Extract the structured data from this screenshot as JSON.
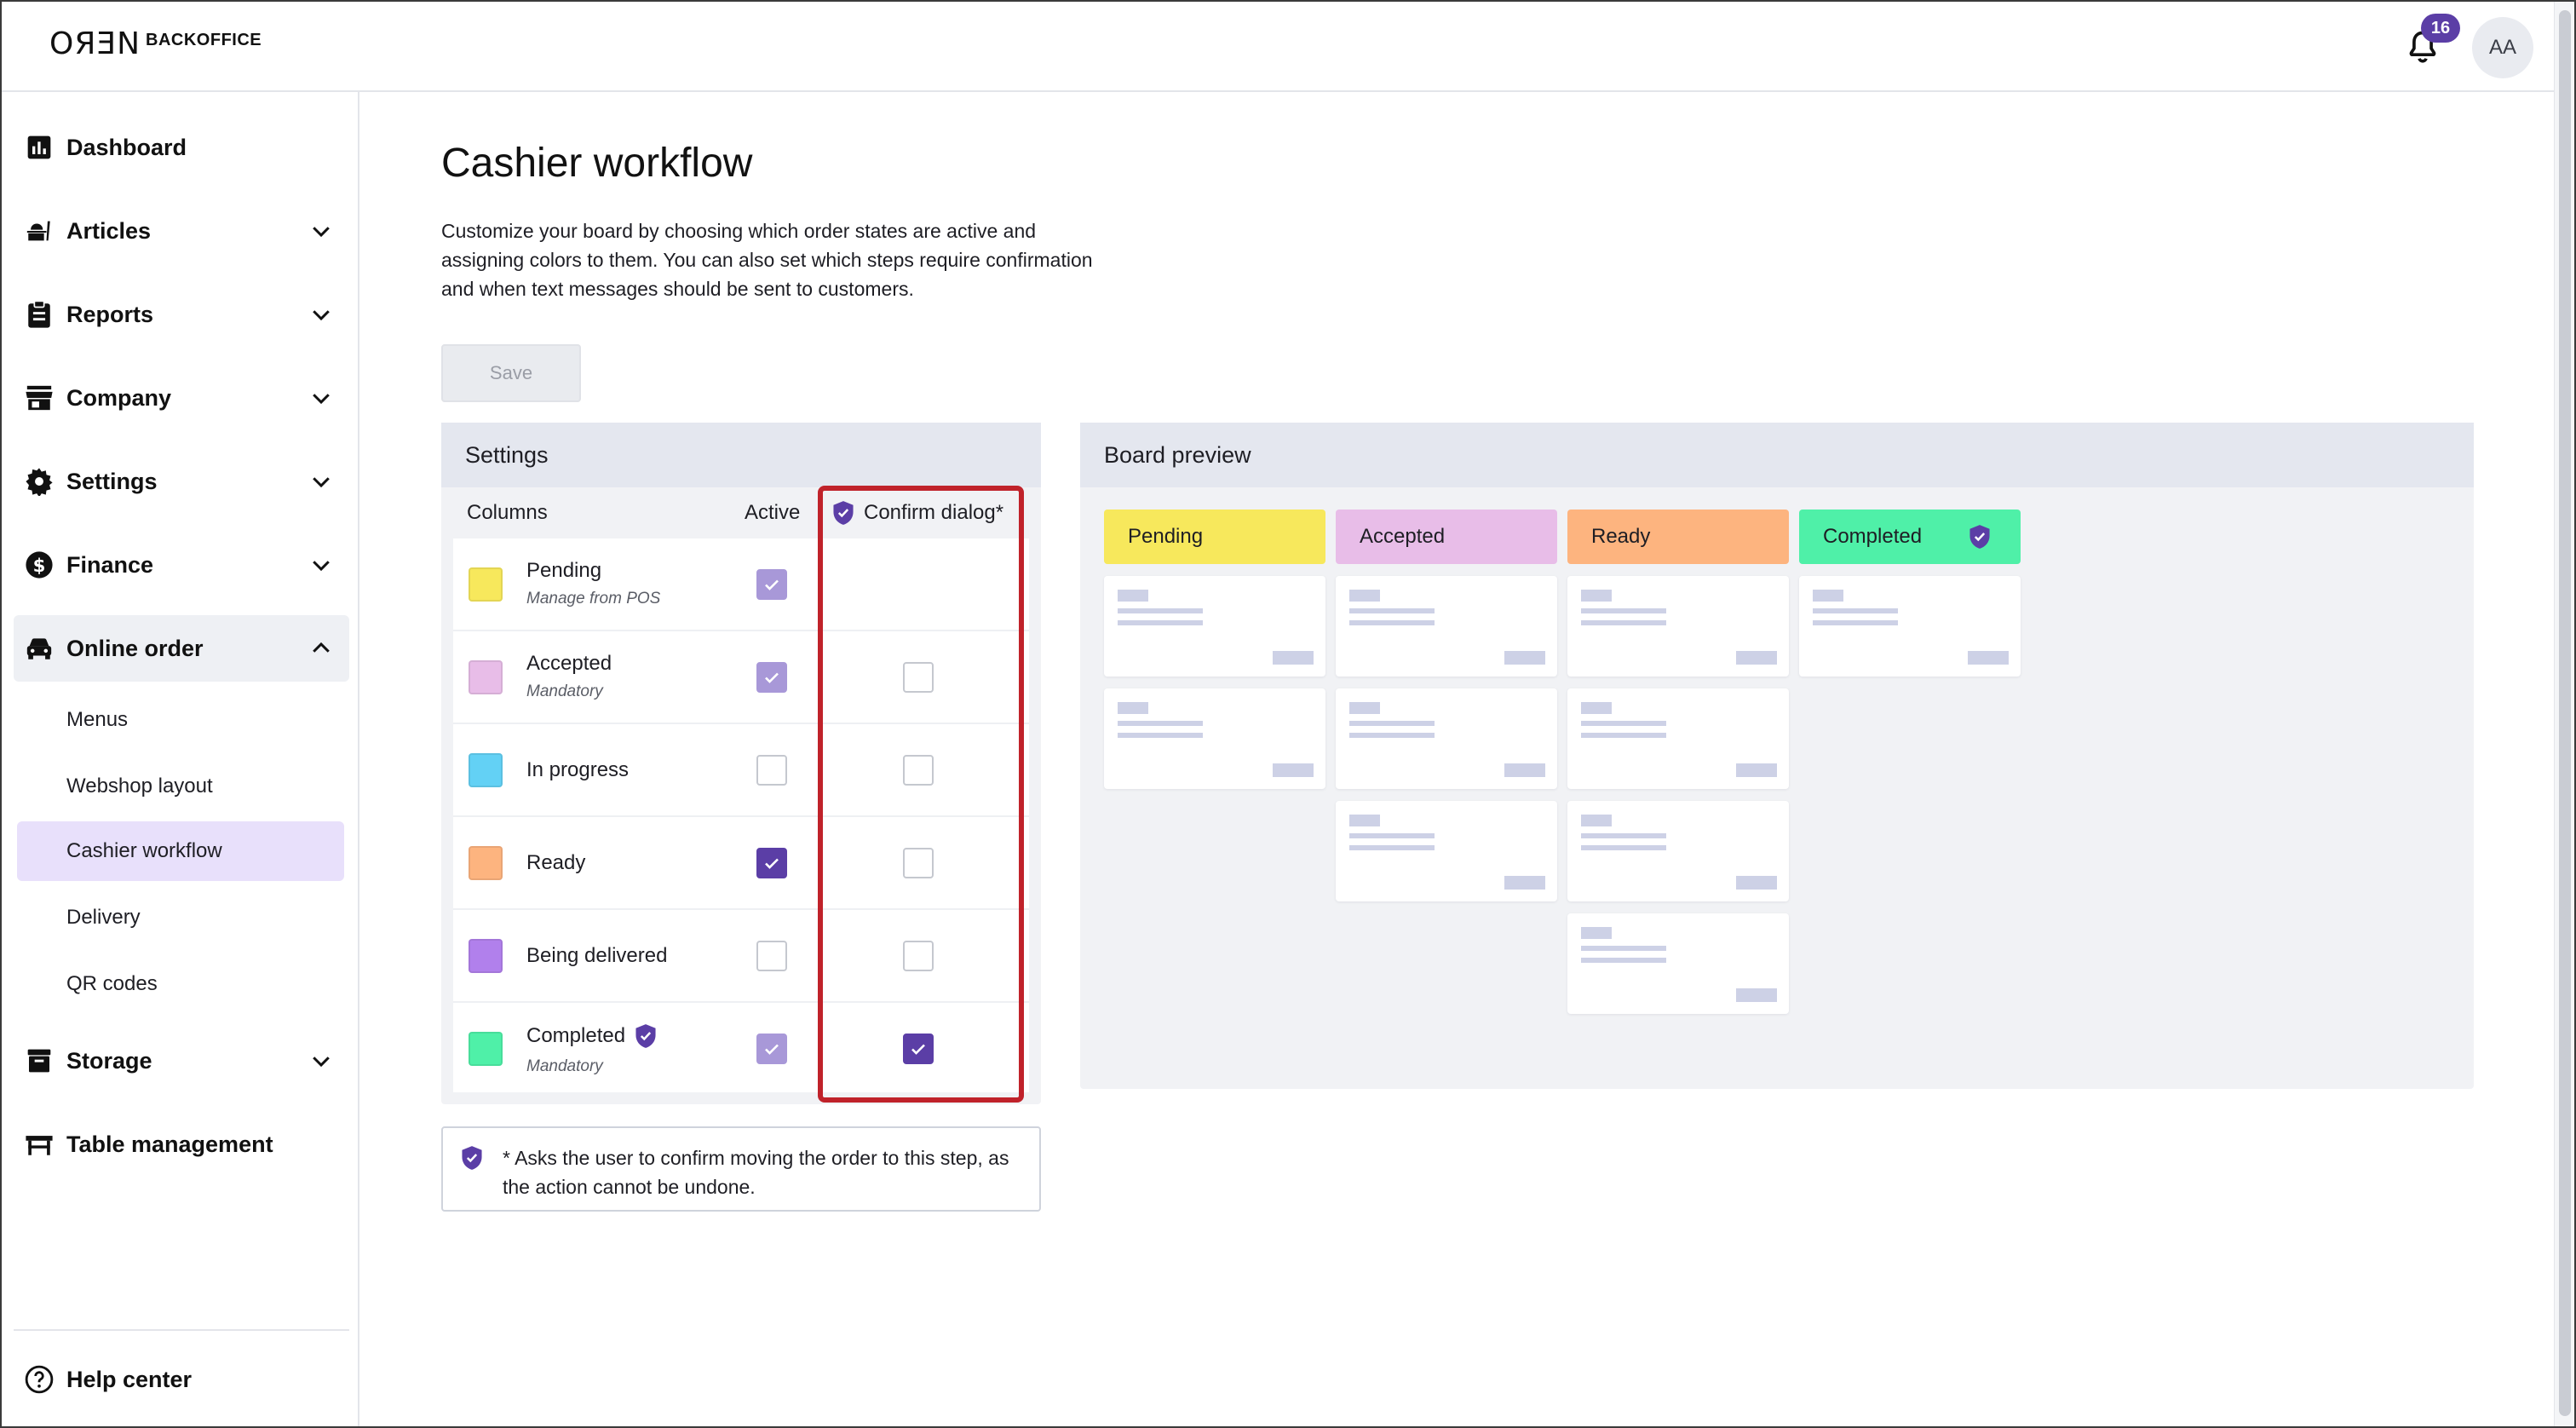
{
  "app": {
    "logo_mark": "OЯƎN",
    "logo_text": "BACKOFFICE"
  },
  "header": {
    "notification_count": "16",
    "avatar_initials": "AA"
  },
  "sidebar": {
    "items": [
      {
        "label": "Dashboard",
        "icon": "bar-chart-icon"
      },
      {
        "label": "Articles",
        "icon": "articles-icon"
      },
      {
        "label": "Reports",
        "icon": "clipboard-icon"
      },
      {
        "label": "Company",
        "icon": "store-icon"
      },
      {
        "label": "Settings",
        "icon": "gear-icon"
      },
      {
        "label": "Finance",
        "icon": "dollar-icon"
      },
      {
        "label": "Online order",
        "icon": "car-icon"
      },
      {
        "label": "Storage",
        "icon": "archive-icon"
      },
      {
        "label": "Table management",
        "icon": "table-icon"
      }
    ],
    "online_order_sub": [
      "Menus",
      "Webshop layout",
      "Cashier workflow",
      "Delivery",
      "QR codes"
    ],
    "help": "Help center"
  },
  "main": {
    "title": "Cashier workflow",
    "description": "Customize your board by choosing which order states are active and assigning colors to them. You can also set which steps require confirmation and when text messages should be sent to customers.",
    "save_label": "Save"
  },
  "settings": {
    "title": "Settings",
    "headers": {
      "columns": "Columns",
      "active": "Active",
      "confirm": "Confirm dialog*"
    },
    "rows": [
      {
        "name": "Pending",
        "sub": "Manage from POS",
        "color": "#f7e85c",
        "active": true,
        "active_disabled": true,
        "confirm": null
      },
      {
        "name": "Accepted",
        "sub": "Mandatory",
        "color": "#e8bde8",
        "active": true,
        "active_disabled": true,
        "confirm": false
      },
      {
        "name": "In progress",
        "sub": "",
        "color": "#63d1f5",
        "active": false,
        "active_disabled": false,
        "confirm": false
      },
      {
        "name": "Ready",
        "sub": "",
        "color": "#fdb47f",
        "active": true,
        "active_disabled": false,
        "confirm": false
      },
      {
        "name": "Being delivered",
        "sub": "",
        "color": "#b180ec",
        "active": false,
        "active_disabled": false,
        "confirm": false
      },
      {
        "name": "Completed",
        "sub": "Mandatory",
        "color": "#4ff0a8",
        "active": true,
        "active_disabled": true,
        "confirm": true
      }
    ],
    "note": "* Asks the user to confirm moving the order to this step, as the action cannot be undone."
  },
  "preview": {
    "title": "Board preview",
    "columns": [
      {
        "label": "Pending",
        "color": "#f7e85c",
        "cards": 2
      },
      {
        "label": "Accepted",
        "color": "#e8bde8",
        "cards": 3
      },
      {
        "label": "Ready",
        "color": "#fdb47f",
        "cards": 4
      },
      {
        "label": "Completed",
        "color": "#4ff0a8",
        "cards": 1,
        "shield": true
      }
    ]
  },
  "colors": {
    "accent": "#5b3ea6",
    "highlight": "#c0222a"
  }
}
